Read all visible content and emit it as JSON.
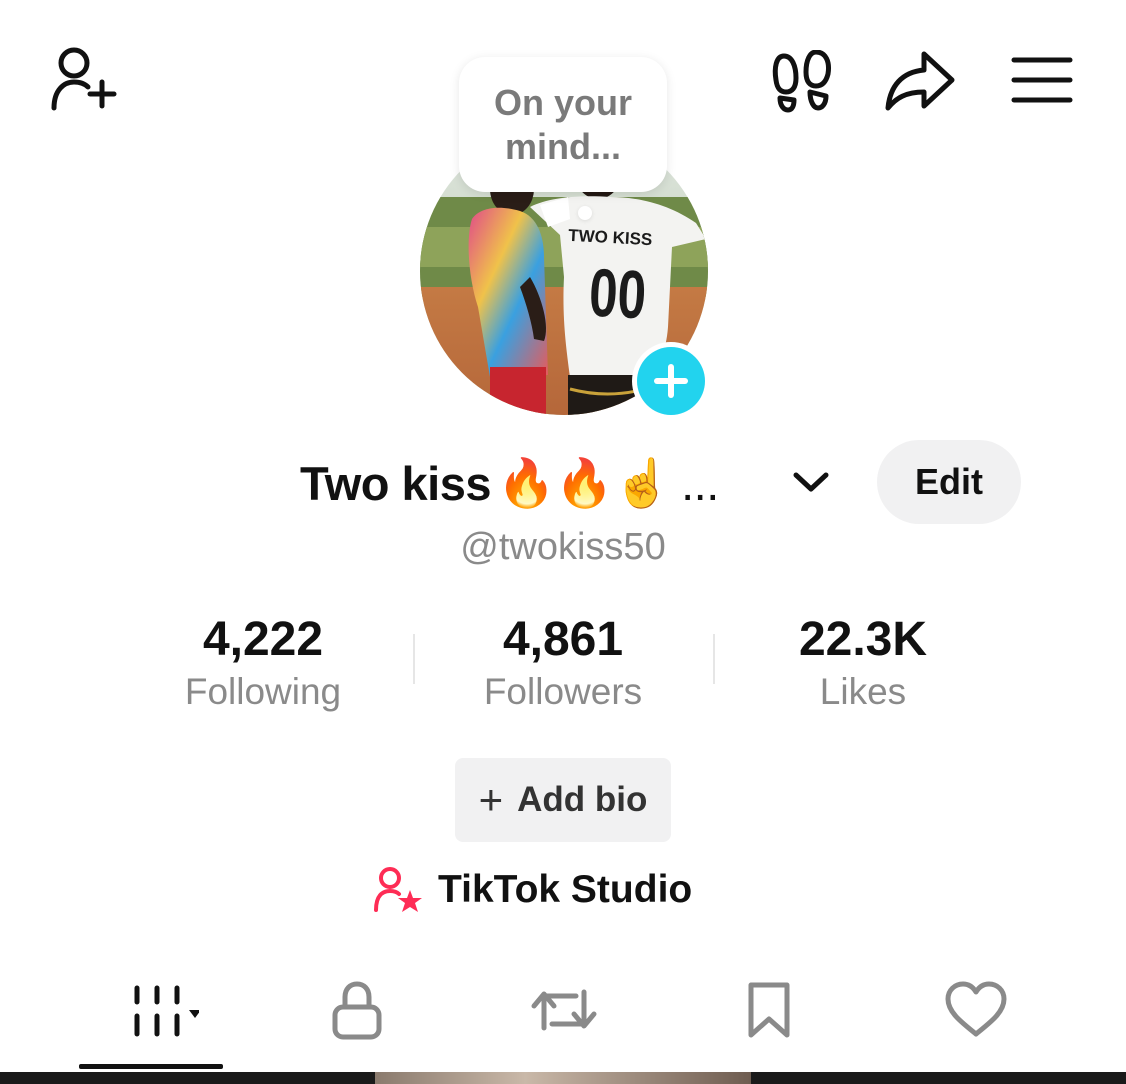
{
  "header": {
    "add_friend_icon": "person-plus-icon",
    "footprints_icon": "footprints-icon",
    "share_icon": "share-arrow-icon",
    "menu_icon": "hamburger-menu-icon"
  },
  "bubble": {
    "text": "On your mind..."
  },
  "profile": {
    "display_name": "Two kiss",
    "name_emojis": "🔥🔥☝️",
    "name_ellipsis": "...",
    "username": "@twokiss50",
    "edit_label": "Edit",
    "avatar_alt": "Profile photo: two people, one in TWO KISS 00 jersey",
    "jersey_name": "TWO KISS",
    "jersey_number": "00"
  },
  "stats": [
    {
      "value": "4,222",
      "label": "Following"
    },
    {
      "value": "4,861",
      "label": "Followers"
    },
    {
      "value": "22.3K",
      "label": "Likes"
    }
  ],
  "bio": {
    "add_label": "Add bio",
    "add_symbol": "+"
  },
  "studio": {
    "label": "TikTok Studio",
    "icon": "person-star-icon"
  },
  "tabs": [
    {
      "name": "videos",
      "icon": "grid-bars-icon",
      "active": true
    },
    {
      "name": "private",
      "icon": "lock-icon",
      "active": false
    },
    {
      "name": "reposts",
      "icon": "repost-icon",
      "active": false
    },
    {
      "name": "favorites",
      "icon": "bookmark-icon",
      "active": false
    },
    {
      "name": "liked",
      "icon": "heart-icon",
      "active": false
    }
  ],
  "colors": {
    "accent_cyan": "#22d3ee",
    "studio_pink": "#fe2c55",
    "muted_text": "#8a8a8a",
    "pill_bg": "#f1f1f2"
  }
}
